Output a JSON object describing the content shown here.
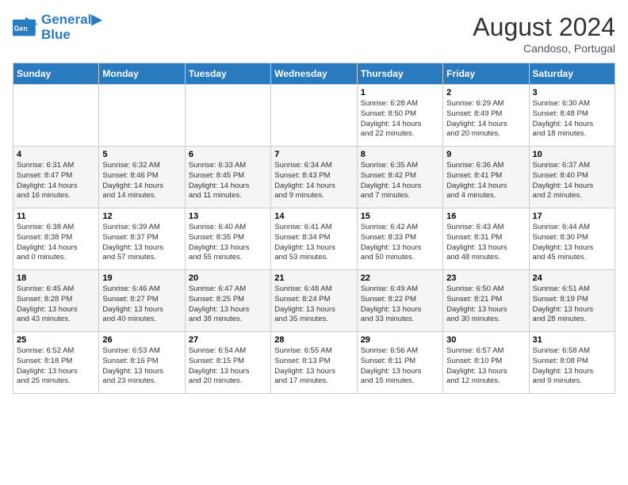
{
  "header": {
    "logo_line1": "General",
    "logo_line2": "Blue",
    "month_year": "August 2024",
    "location": "Candoso, Portugal"
  },
  "days_of_week": [
    "Sunday",
    "Monday",
    "Tuesday",
    "Wednesday",
    "Thursday",
    "Friday",
    "Saturday"
  ],
  "weeks": [
    [
      {
        "day": "",
        "info": ""
      },
      {
        "day": "",
        "info": ""
      },
      {
        "day": "",
        "info": ""
      },
      {
        "day": "",
        "info": ""
      },
      {
        "day": "1",
        "info": "Sunrise: 6:28 AM\nSunset: 8:50 PM\nDaylight: 14 hours\nand 22 minutes."
      },
      {
        "day": "2",
        "info": "Sunrise: 6:29 AM\nSunset: 8:49 PM\nDaylight: 14 hours\nand 20 minutes."
      },
      {
        "day": "3",
        "info": "Sunrise: 6:30 AM\nSunset: 8:48 PM\nDaylight: 14 hours\nand 18 minutes."
      }
    ],
    [
      {
        "day": "4",
        "info": "Sunrise: 6:31 AM\nSunset: 8:47 PM\nDaylight: 14 hours\nand 16 minutes."
      },
      {
        "day": "5",
        "info": "Sunrise: 6:32 AM\nSunset: 8:46 PM\nDaylight: 14 hours\nand 14 minutes."
      },
      {
        "day": "6",
        "info": "Sunrise: 6:33 AM\nSunset: 8:45 PM\nDaylight: 14 hours\nand 11 minutes."
      },
      {
        "day": "7",
        "info": "Sunrise: 6:34 AM\nSunset: 8:43 PM\nDaylight: 14 hours\nand 9 minutes."
      },
      {
        "day": "8",
        "info": "Sunrise: 6:35 AM\nSunset: 8:42 PM\nDaylight: 14 hours\nand 7 minutes."
      },
      {
        "day": "9",
        "info": "Sunrise: 6:36 AM\nSunset: 8:41 PM\nDaylight: 14 hours\nand 4 minutes."
      },
      {
        "day": "10",
        "info": "Sunrise: 6:37 AM\nSunset: 8:40 PM\nDaylight: 14 hours\nand 2 minutes."
      }
    ],
    [
      {
        "day": "11",
        "info": "Sunrise: 6:38 AM\nSunset: 8:38 PM\nDaylight: 14 hours\nand 0 minutes."
      },
      {
        "day": "12",
        "info": "Sunrise: 6:39 AM\nSunset: 8:37 PM\nDaylight: 13 hours\nand 57 minutes."
      },
      {
        "day": "13",
        "info": "Sunrise: 6:40 AM\nSunset: 8:35 PM\nDaylight: 13 hours\nand 55 minutes."
      },
      {
        "day": "14",
        "info": "Sunrise: 6:41 AM\nSunset: 8:34 PM\nDaylight: 13 hours\nand 53 minutes."
      },
      {
        "day": "15",
        "info": "Sunrise: 6:42 AM\nSunset: 8:33 PM\nDaylight: 13 hours\nand 50 minutes."
      },
      {
        "day": "16",
        "info": "Sunrise: 6:43 AM\nSunset: 8:31 PM\nDaylight: 13 hours\nand 48 minutes."
      },
      {
        "day": "17",
        "info": "Sunrise: 6:44 AM\nSunset: 8:30 PM\nDaylight: 13 hours\nand 45 minutes."
      }
    ],
    [
      {
        "day": "18",
        "info": "Sunrise: 6:45 AM\nSunset: 8:28 PM\nDaylight: 13 hours\nand 43 minutes."
      },
      {
        "day": "19",
        "info": "Sunrise: 6:46 AM\nSunset: 8:27 PM\nDaylight: 13 hours\nand 40 minutes."
      },
      {
        "day": "20",
        "info": "Sunrise: 6:47 AM\nSunset: 8:25 PM\nDaylight: 13 hours\nand 38 minutes."
      },
      {
        "day": "21",
        "info": "Sunrise: 6:48 AM\nSunset: 8:24 PM\nDaylight: 13 hours\nand 35 minutes."
      },
      {
        "day": "22",
        "info": "Sunrise: 6:49 AM\nSunset: 8:22 PM\nDaylight: 13 hours\nand 33 minutes."
      },
      {
        "day": "23",
        "info": "Sunrise: 6:50 AM\nSunset: 8:21 PM\nDaylight: 13 hours\nand 30 minutes."
      },
      {
        "day": "24",
        "info": "Sunrise: 6:51 AM\nSunset: 8:19 PM\nDaylight: 13 hours\nand 28 minutes."
      }
    ],
    [
      {
        "day": "25",
        "info": "Sunrise: 6:52 AM\nSunset: 8:18 PM\nDaylight: 13 hours\nand 25 minutes."
      },
      {
        "day": "26",
        "info": "Sunrise: 6:53 AM\nSunset: 8:16 PM\nDaylight: 13 hours\nand 23 minutes."
      },
      {
        "day": "27",
        "info": "Sunrise: 6:54 AM\nSunset: 8:15 PM\nDaylight: 13 hours\nand 20 minutes."
      },
      {
        "day": "28",
        "info": "Sunrise: 6:55 AM\nSunset: 8:13 PM\nDaylight: 13 hours\nand 17 minutes."
      },
      {
        "day": "29",
        "info": "Sunrise: 6:56 AM\nSunset: 8:11 PM\nDaylight: 13 hours\nand 15 minutes."
      },
      {
        "day": "30",
        "info": "Sunrise: 6:57 AM\nSunset: 8:10 PM\nDaylight: 13 hours\nand 12 minutes."
      },
      {
        "day": "31",
        "info": "Sunrise: 6:58 AM\nSunset: 8:08 PM\nDaylight: 13 hours\nand 9 minutes."
      }
    ]
  ]
}
